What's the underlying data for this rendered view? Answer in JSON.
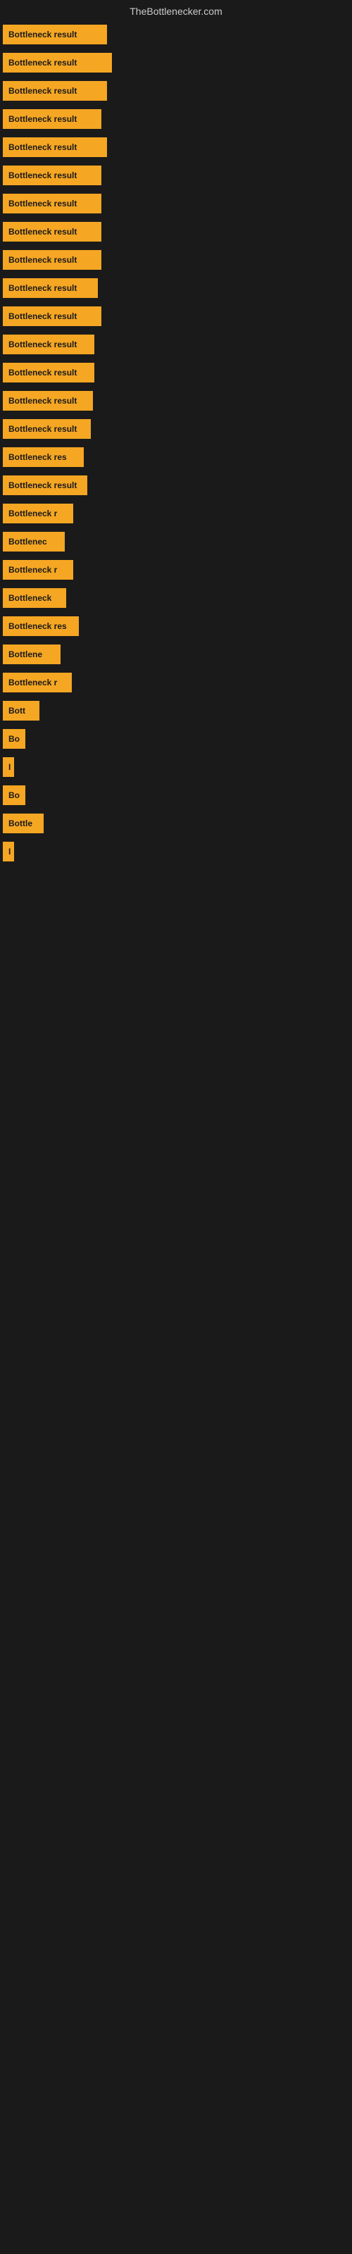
{
  "header": {
    "title": "TheBottlenecker.com"
  },
  "items": [
    {
      "label": "Bottleneck result",
      "width": 148
    },
    {
      "label": "Bottleneck result",
      "width": 155
    },
    {
      "label": "Bottleneck result",
      "width": 148
    },
    {
      "label": "Bottleneck result",
      "width": 140
    },
    {
      "label": "Bottleneck result",
      "width": 148
    },
    {
      "label": "Bottleneck result",
      "width": 140
    },
    {
      "label": "Bottleneck result",
      "width": 140
    },
    {
      "label": "Bottleneck result",
      "width": 140
    },
    {
      "label": "Bottleneck result",
      "width": 140
    },
    {
      "label": "Bottleneck result",
      "width": 135
    },
    {
      "label": "Bottleneck result",
      "width": 140
    },
    {
      "label": "Bottleneck result",
      "width": 130
    },
    {
      "label": "Bottleneck result",
      "width": 130
    },
    {
      "label": "Bottleneck result",
      "width": 128
    },
    {
      "label": "Bottleneck result",
      "width": 125
    },
    {
      "label": "Bottleneck res",
      "width": 115
    },
    {
      "label": "Bottleneck result",
      "width": 120
    },
    {
      "label": "Bottleneck r",
      "width": 100
    },
    {
      "label": "Bottlenec",
      "width": 88
    },
    {
      "label": "Bottleneck r",
      "width": 100
    },
    {
      "label": "Bottleneck",
      "width": 90
    },
    {
      "label": "Bottleneck res",
      "width": 108
    },
    {
      "label": "Bottlene",
      "width": 82
    },
    {
      "label": "Bottleneck r",
      "width": 98
    },
    {
      "label": "Bott",
      "width": 52
    },
    {
      "label": "Bo",
      "width": 32
    },
    {
      "label": "I",
      "width": 10
    },
    {
      "label": "Bo",
      "width": 32
    },
    {
      "label": "Bottle",
      "width": 58
    },
    {
      "label": "I",
      "width": 10
    }
  ]
}
